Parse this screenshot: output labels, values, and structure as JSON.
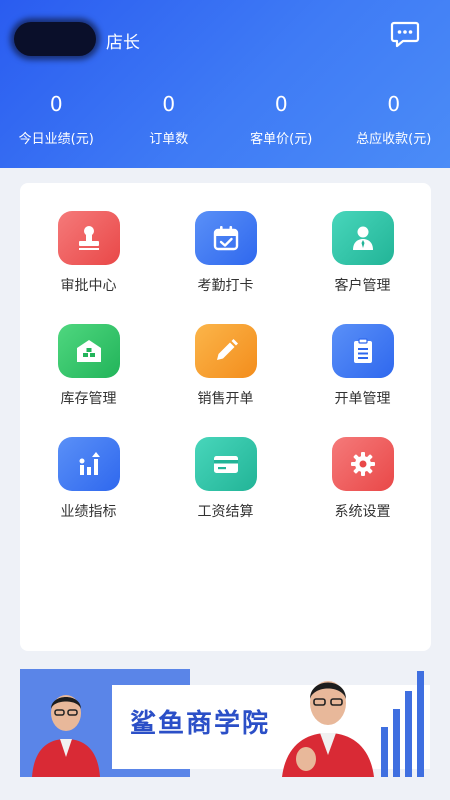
{
  "header": {
    "role_label": "店长",
    "stats": [
      {
        "value": "0",
        "label": "今日业绩(元)"
      },
      {
        "value": "0",
        "label": "订单数"
      },
      {
        "value": "0",
        "label": "客单价(元)"
      },
      {
        "value": "0",
        "label": "总应收款(元)"
      }
    ]
  },
  "menu": [
    {
      "label": "审批中心",
      "icon": "stamp-icon",
      "color": "#ef5a5a"
    },
    {
      "label": "考勤打卡",
      "icon": "calendar-check-icon",
      "color": "#3f7bf5"
    },
    {
      "label": "客户管理",
      "icon": "user-tie-icon",
      "color": "#2ec4a8"
    },
    {
      "label": "库存管理",
      "icon": "warehouse-icon",
      "color": "#33c46b"
    },
    {
      "label": "销售开单",
      "icon": "pencil-icon",
      "color": "#f7a22e"
    },
    {
      "label": "开单管理",
      "icon": "clipboard-icon",
      "color": "#3f7bf5"
    },
    {
      "label": "业绩指标",
      "icon": "performance-chart-icon",
      "color": "#3f7bf5"
    },
    {
      "label": "工资结算",
      "icon": "card-icon",
      "color": "#2ec4a8"
    },
    {
      "label": "系统设置",
      "icon": "gear-icon",
      "color": "#ef5a5a"
    }
  ],
  "banner": {
    "title": "鲨鱼商学院"
  },
  "colors": {
    "header_start": "#2a5cf0",
    "header_end": "#4b8cf7",
    "page_bg": "#eef1f7"
  }
}
